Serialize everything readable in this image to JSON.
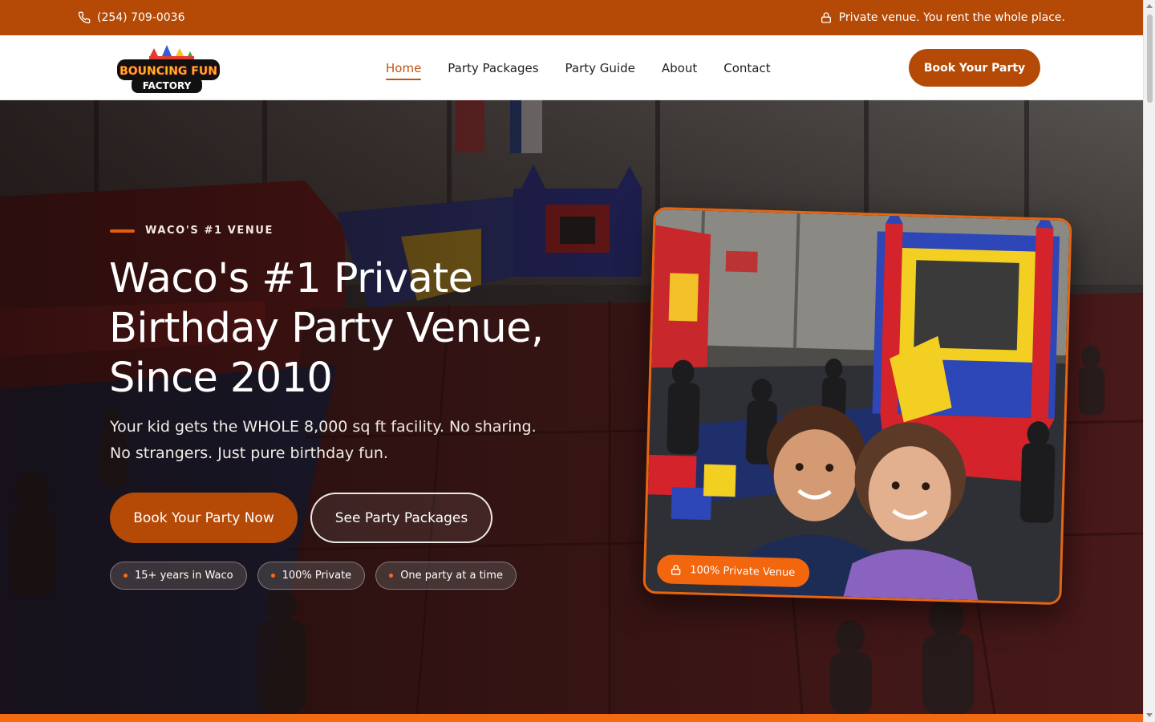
{
  "topbar": {
    "phone": "(254) 709-0036",
    "notice": "Private venue. You rent the whole place.",
    "bg_color": "#b54a07",
    "phone_icon": "phone-icon",
    "notice_icon": "lock-icon"
  },
  "logo": {
    "line1": "BOUNCING FUN",
    "line2": "FACTORY"
  },
  "nav": {
    "items": [
      {
        "label": "Home",
        "active": true
      },
      {
        "label": "Party Packages",
        "active": false
      },
      {
        "label": "Party Guide",
        "active": false
      },
      {
        "label": "About",
        "active": false
      },
      {
        "label": "Contact",
        "active": false
      }
    ],
    "cta": "Book Your Party",
    "accent_color": "#c2550e"
  },
  "hero": {
    "eyebrow": "WACO'S #1 VENUE",
    "title_lines": [
      "Waco's #1 Private",
      "Birthday Party Venue,",
      "Since 2010"
    ],
    "subtitle": "Your kid gets the WHOLE 8,000 sq ft facility. No sharing. No strangers. Just pure birthday fun.",
    "primary_button": "Book Your Party Now",
    "secondary_button": "See Party Packages",
    "chips": [
      "15+ years in Waco",
      "100% Private",
      "One party at a time"
    ],
    "photo_badge": "100% Private Venue",
    "photo_badge_icon": "lock-icon",
    "badge_color": "#f2660e"
  }
}
